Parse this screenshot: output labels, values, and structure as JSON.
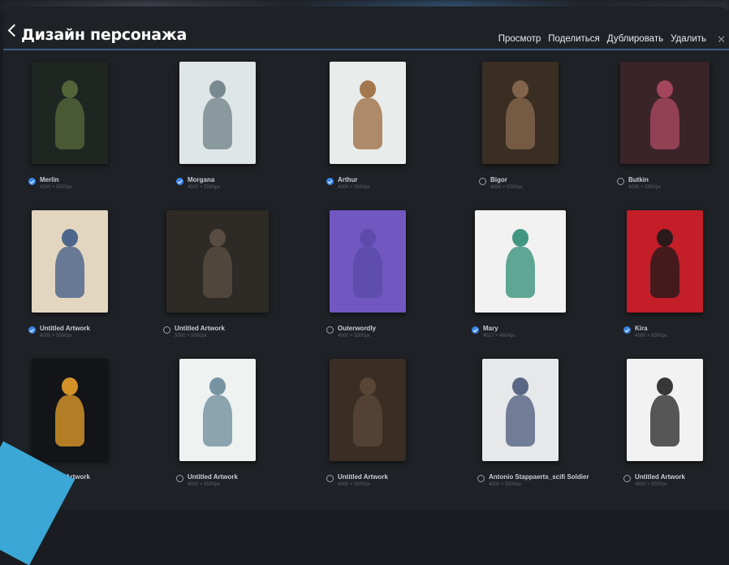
{
  "header": {
    "title": "Дизайн персонажа",
    "actions": [
      "Просмотр",
      "Поделиться",
      "Дублировать",
      "Удалить"
    ]
  },
  "icons": {
    "back": "chevron-left-icon",
    "close": "close-icon",
    "selected": "checkmark-circle-icon",
    "unselected": "empty-circle-icon"
  },
  "colors": {
    "accent": "#3a86e8",
    "divider": "#3d5f86",
    "background": "#1e2125"
  },
  "artworks": [
    {
      "name": "Merlin",
      "dims": "4000 × 5500px",
      "selected": true
    },
    {
      "name": "Morgana",
      "dims": "4000 × 5500px",
      "selected": true
    },
    {
      "name": "Arthur",
      "dims": "4000 × 5500px",
      "selected": true
    },
    {
      "name": "Bigor",
      "dims": "4000 × 5500px",
      "selected": false
    },
    {
      "name": "Butkin",
      "dims": "4000 × 5500px",
      "selected": false
    },
    {
      "name": "Untitled Artwork",
      "dims": "4000 × 5500px",
      "selected": true
    },
    {
      "name": "Untitled Artwork",
      "dims": "5000 × 5000px",
      "selected": false
    },
    {
      "name": "Outerwordly",
      "dims": "4000 × 5500px",
      "selected": false
    },
    {
      "name": "Mary",
      "dims": "4017 × 4654px",
      "selected": true
    },
    {
      "name": "Kira",
      "dims": "4000 × 5500px",
      "selected": true
    },
    {
      "name": "Untitled Artwork",
      "dims": "4000 × 5500px",
      "selected": false
    },
    {
      "name": "Untitled Artwork",
      "dims": "4000 × 5500px",
      "selected": false
    },
    {
      "name": "Untitled Artwork",
      "dims": "4000 × 5500px",
      "selected": false
    },
    {
      "name": "Antonio Stappaerts_scifi Soldier",
      "dims": "4000 × 5500px",
      "selected": false
    },
    {
      "name": "Untitled Artwork",
      "dims": "4500 × 5500px",
      "selected": false
    }
  ]
}
